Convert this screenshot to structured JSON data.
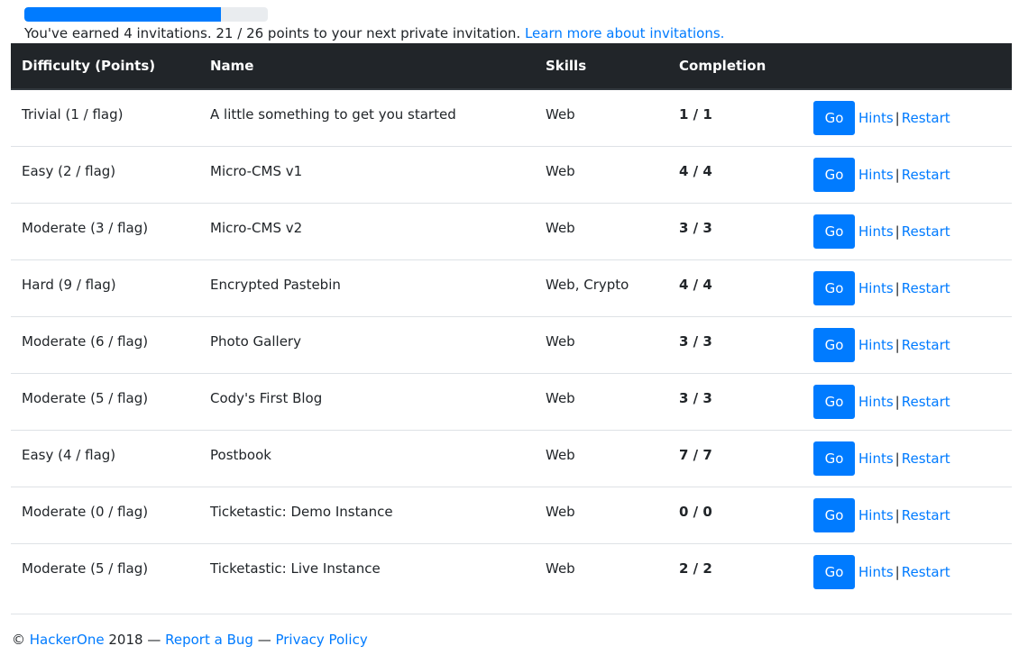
{
  "invitations": {
    "progress_fraction": 0.8077,
    "text": "You've earned 4 invitations. 21 / 26 points to your next private invitation.",
    "learn_more_link": "Learn more about invitations."
  },
  "table": {
    "headers": [
      "Difficulty (Points)",
      "Name",
      "Skills",
      "Completion"
    ],
    "rows": [
      {
        "difficulty": "Trivial (1 / flag)",
        "name": "A little something to get you started",
        "skills": "Web",
        "completion": "1 / 1"
      },
      {
        "difficulty": "Easy (2 / flag)",
        "name": "Micro-CMS v1",
        "skills": "Web",
        "completion": "4 / 4"
      },
      {
        "difficulty": "Moderate (3 / flag)",
        "name": "Micro-CMS v2",
        "skills": "Web",
        "completion": "3 / 3"
      },
      {
        "difficulty": "Hard (9 / flag)",
        "name": "Encrypted Pastebin",
        "skills": "Web, Crypto",
        "completion": "4 / 4"
      },
      {
        "difficulty": "Moderate (6 / flag)",
        "name": "Photo Gallery",
        "skills": "Web",
        "completion": "3 / 3"
      },
      {
        "difficulty": "Moderate (5 / flag)",
        "name": "Cody's First Blog",
        "skills": "Web",
        "completion": "3 / 3"
      },
      {
        "difficulty": "Easy (4 / flag)",
        "name": "Postbook",
        "skills": "Web",
        "completion": "7 / 7"
      },
      {
        "difficulty": "Moderate (0 / flag)",
        "name": "Ticketastic: Demo Instance",
        "skills": "Web",
        "completion": "0 / 0"
      },
      {
        "difficulty": "Moderate (5 / flag)",
        "name": "Ticketastic: Live Instance",
        "skills": "Web",
        "completion": "2 / 2"
      }
    ],
    "actions": {
      "go_label": "Go",
      "hints_label": "Hints",
      "separator": "|",
      "restart_label": "Restart"
    }
  },
  "footer": {
    "copyright_symbol": "©",
    "company_link": "HackerOne",
    "year": "2018",
    "dash": "—",
    "report_bug_link": "Report a Bug",
    "privacy_link": "Privacy Policy"
  },
  "colors": {
    "accent": "#007bff",
    "header_bg": "#212529",
    "progress_track": "#e9ecef"
  }
}
